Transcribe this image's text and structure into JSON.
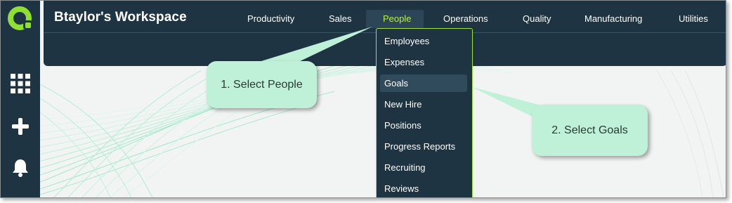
{
  "header": {
    "workspace_title": "Btaylor's Workspace",
    "nav": [
      "Productivity",
      "Sales",
      "People",
      "Operations",
      "Quality",
      "Manufacturing",
      "Utilities"
    ],
    "active_nav": "People"
  },
  "dropdown": {
    "items": [
      "Employees",
      "Expenses",
      "Goals",
      "New Hire",
      "Positions",
      "Progress Reports",
      "Recruiting",
      "Reviews"
    ],
    "highlighted": "Goals"
  },
  "rail": {
    "icons": [
      "app-logo-icon",
      "apps-grid-icon",
      "plus-icon",
      "bell-icon"
    ]
  },
  "callouts": {
    "step1": "1. Select People",
    "step2": "2. Select Goals"
  },
  "colors": {
    "navy": "#1e3442",
    "accent_green": "#b6f04a",
    "logo_green": "#8fe032",
    "callout_bg": "#bff0d8"
  }
}
